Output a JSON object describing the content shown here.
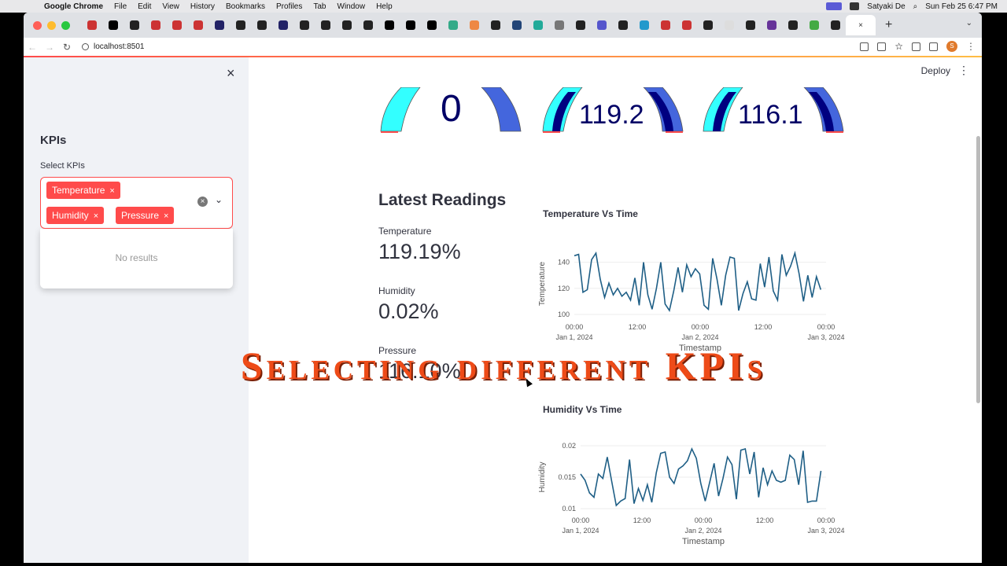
{
  "menubar": {
    "app_name": "Google Chrome",
    "menus": [
      "File",
      "Edit",
      "View",
      "History",
      "Bookmarks",
      "Profiles",
      "Tab",
      "Window",
      "Help"
    ],
    "user": "Satyaki De",
    "datetime": "Sun Feb 25  6:47 PM"
  },
  "browser": {
    "url": "localhost:8501",
    "avatar_letter": "S"
  },
  "sidebar": {
    "heading": "KPIs",
    "select_label": "Select KPIs",
    "selected": [
      "Temperature",
      "Humidity",
      "Pressure"
    ],
    "chip_close": "×",
    "dropdown_empty": "No results",
    "close_icon": "×"
  },
  "header": {
    "deploy_label": "Deploy",
    "menu_icon": "⋮"
  },
  "gauges": [
    {
      "value": "0"
    },
    {
      "value": "119.2"
    },
    {
      "value": "116.1"
    }
  ],
  "latest": {
    "title": "Latest Readings",
    "metrics": [
      {
        "label": "Temperature",
        "value": "119.19%"
      },
      {
        "label": "Humidity",
        "value": "0.02%"
      },
      {
        "label": "Pressure",
        "value": "116.10%"
      }
    ]
  },
  "overlay_caption": "Selecting different KPIs",
  "colors": {
    "accent": "#ff4b4b",
    "line": "#1f5f86",
    "gauge_cyan": "#33ffff",
    "gauge_navy": "#000080",
    "gauge_blue": "#4466dd",
    "overlay": "#ee4b18"
  },
  "chart_data": [
    {
      "type": "line",
      "title": "Temperature Vs Time",
      "xlabel": "Timestamp",
      "ylabel": "Temperature",
      "x_ticks": [
        {
          "line1": "00:00",
          "line2": "Jan 1, 2024"
        },
        {
          "line1": "12:00",
          "line2": ""
        },
        {
          "line1": "00:00",
          "line2": "Jan 2, 2024"
        },
        {
          "line1": "12:00",
          "line2": ""
        },
        {
          "line1": "00:00",
          "line2": "Jan 3, 2024"
        }
      ],
      "yticks": [
        100,
        120,
        140
      ],
      "ylim": [
        97,
        150
      ],
      "x_range_hours": [
        0,
        48
      ],
      "values": [
        145,
        146,
        117,
        119,
        142,
        147,
        127,
        113,
        124,
        115,
        120,
        114,
        117,
        111,
        128,
        107,
        140,
        115,
        104,
        120,
        140,
        108,
        103,
        118,
        136,
        117,
        138,
        129,
        135,
        131,
        107,
        104,
        143,
        127,
        107,
        130,
        144,
        143,
        103,
        116,
        125,
        112,
        111,
        139,
        121,
        144,
        118,
        111,
        146,
        130,
        137,
        147,
        131,
        110,
        130,
        113,
        129,
        119
      ]
    },
    {
      "type": "line",
      "title": "Humidity Vs Time",
      "xlabel": "Timestamp",
      "ylabel": "Humidity",
      "x_ticks": [
        {
          "line1": "00:00",
          "line2": "Jan 1, 2024"
        },
        {
          "line1": "12:00",
          "line2": ""
        },
        {
          "line1": "00:00",
          "line2": "Jan 2, 2024"
        },
        {
          "line1": "12:00",
          "line2": ""
        },
        {
          "line1": "00:00",
          "line2": "Jan 3, 2024"
        }
      ],
      "yticks": [
        0.01,
        0.015,
        0.02
      ],
      "ylim": [
        0.0095,
        0.0205
      ],
      "x_range_hours": [
        0,
        48
      ],
      "values": [
        0.0155,
        0.0145,
        0.0125,
        0.0118,
        0.0155,
        0.0148,
        0.0182,
        0.0143,
        0.0105,
        0.0112,
        0.0116,
        0.0178,
        0.0108,
        0.0132,
        0.0113,
        0.0138,
        0.011,
        0.0157,
        0.0188,
        0.019,
        0.015,
        0.014,
        0.0163,
        0.0168,
        0.0176,
        0.0195,
        0.018,
        0.014,
        0.0112,
        0.0142,
        0.0172,
        0.012,
        0.0148,
        0.0182,
        0.017,
        0.0115,
        0.0193,
        0.0195,
        0.0155,
        0.019,
        0.0118,
        0.0165,
        0.0138,
        0.016,
        0.0145,
        0.0142,
        0.0145,
        0.0185,
        0.0178,
        0.0138,
        0.0192,
        0.011,
        0.0112,
        0.0112,
        0.016
      ]
    }
  ]
}
